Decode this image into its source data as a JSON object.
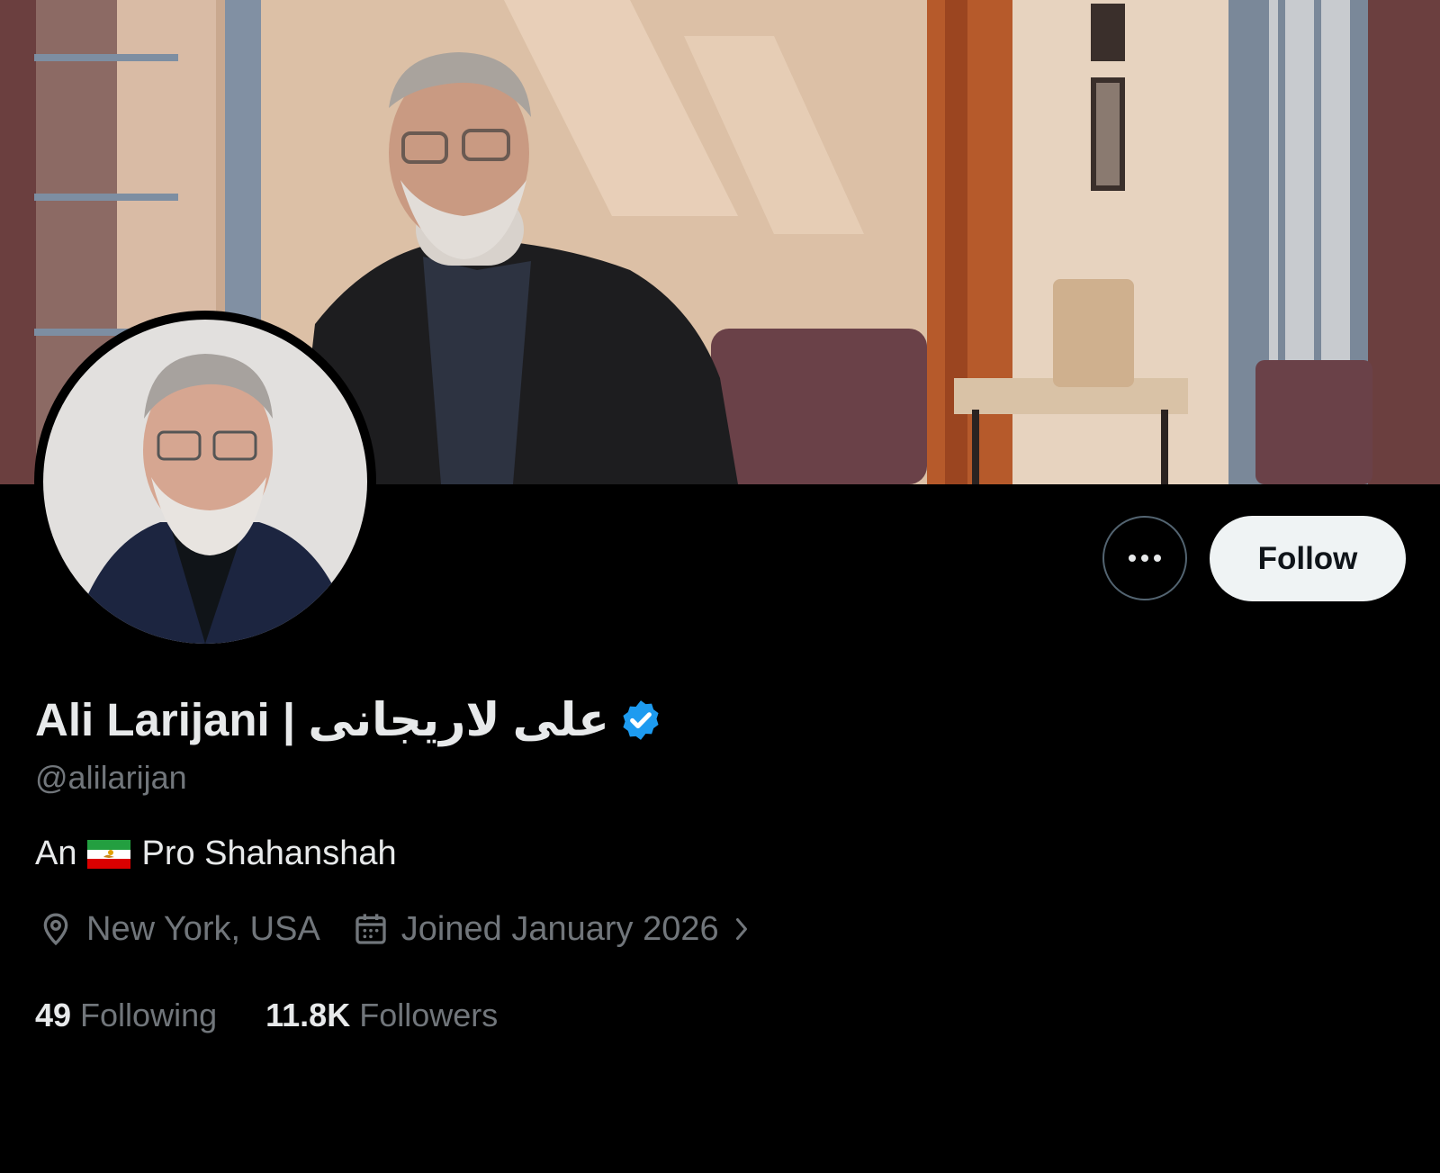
{
  "profile": {
    "display_name": "Ali Larijani | علی لاریجانی",
    "handle": "@alilarijan",
    "verified": true,
    "bio_prefix": "An",
    "bio_suffix": "Pro Shahanshah",
    "bio_flag_icon": "iran-lion-and-sun-flag-icon",
    "location": "New York, USA",
    "joined": "Joined January 2026"
  },
  "actions": {
    "follow_label": "Follow",
    "more_icon": "more-dots-icon"
  },
  "stats": {
    "following_count": "49",
    "following_label": "Following",
    "followers_count": "11.8K",
    "followers_label": "Followers"
  },
  "colors": {
    "background": "#000000",
    "primary_text": "#e7e9ea",
    "secondary_text": "#71767b",
    "verified_badge": "#1d9bf0",
    "follow_button_bg": "#eff3f4"
  }
}
